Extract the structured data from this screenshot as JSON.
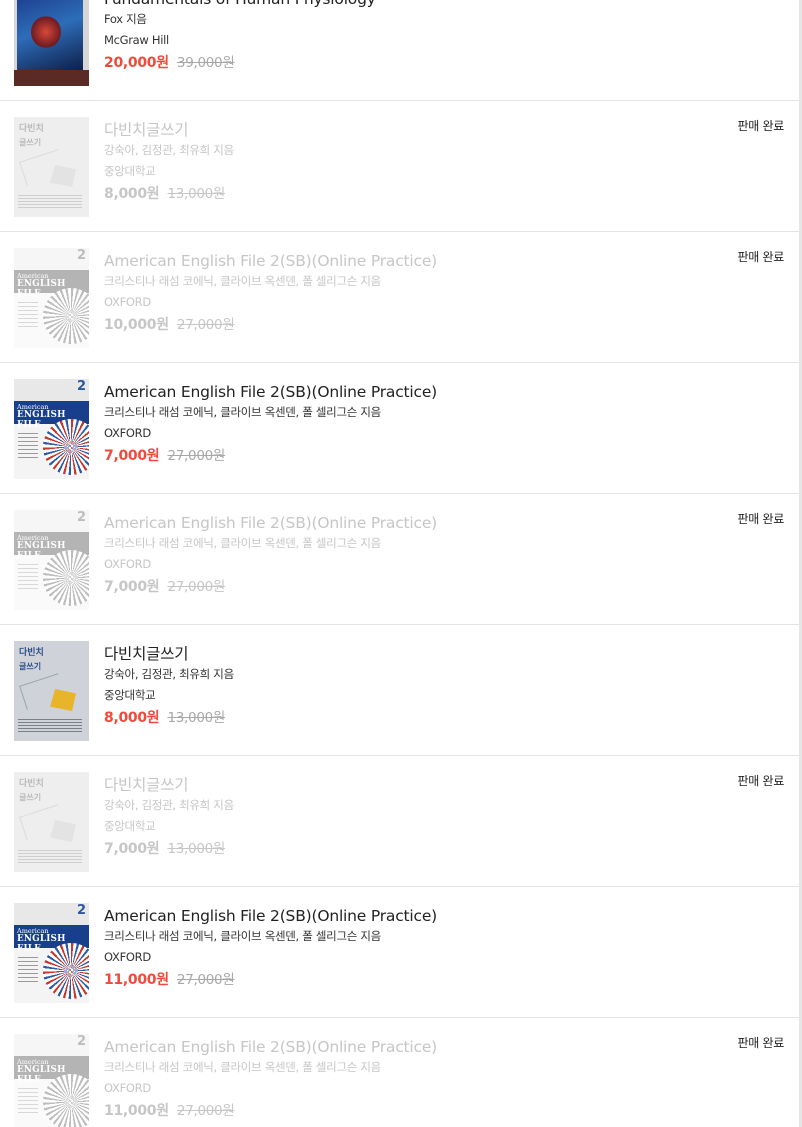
{
  "items": [
    {
      "title": "Fundamentals of Human Physiology",
      "author": "Fox 지음",
      "publisher": "McGraw Hill",
      "price": "20,000원",
      "original_price": "39,000원",
      "status": "",
      "cover_icon": "physiology-book-cover"
    },
    {
      "title": "다빈치글쓰기",
      "author": "강숙아, 김정관, 최유희 지음",
      "publisher": "중앙대학교",
      "price": "8,000원",
      "original_price": "13,000원",
      "status": "판매 완료",
      "cover_icon": "davinci-writing-book-cover"
    },
    {
      "title": "American English File 2(SB)(Online Practice)",
      "author": "크리스티나 래섬 코에닉, 클라이브 옥센덴, 폴 셀리그슨 지음",
      "publisher": "OXFORD",
      "price": "10,000원",
      "original_price": "27,000원",
      "status": "판매 완료",
      "cover_icon": "american-english-file-book-cover"
    },
    {
      "title": "American English File 2(SB)(Online Practice)",
      "author": "크리스티나 래섬 코에닉, 클라이브 옥센덴, 폴 셀리그슨 지음",
      "publisher": "OXFORD",
      "price": "7,000원",
      "original_price": "27,000원",
      "status": "",
      "cover_icon": "american-english-file-book-cover"
    },
    {
      "title": "American English File 2(SB)(Online Practice)",
      "author": "크리스티나 래섬 코에닉, 클라이브 옥센덴, 폴 셀리그슨 지음",
      "publisher": "OXFORD",
      "price": "7,000원",
      "original_price": "27,000원",
      "status": "판매 완료",
      "cover_icon": "american-english-file-book-cover"
    },
    {
      "title": "다빈치글쓰기",
      "author": "강숙아, 김정관, 최유희 지음",
      "publisher": "중앙대학교",
      "price": "8,000원",
      "original_price": "13,000원",
      "status": "",
      "cover_icon": "davinci-writing-book-cover"
    },
    {
      "title": "다빈치글쓰기",
      "author": "강숙아, 김정관, 최유희 지음",
      "publisher": "중앙대학교",
      "price": "7,000원",
      "original_price": "13,000원",
      "status": "판매 완료",
      "cover_icon": "davinci-writing-book-cover"
    },
    {
      "title": "American English File 2(SB)(Online Practice)",
      "author": "크리스티나 래섬 코에닉, 클라이브 옥센덴, 폴 셀리그슨 지음",
      "publisher": "OXFORD",
      "price": "11,000원",
      "original_price": "27,000원",
      "status": "",
      "cover_icon": "american-english-file-book-cover"
    },
    {
      "title": "American English File 2(SB)(Online Practice)",
      "author": "크리스티나 래섬 코에닉, 클라이브 옥센덴, 폴 셀리그슨 지음",
      "publisher": "OXFORD",
      "price": "11,000원",
      "original_price": "27,000원",
      "status": "판매 완료",
      "cover_icon": "american-english-file-book-cover"
    }
  ],
  "cover_text": {
    "davinci_line1": "다빈치",
    "davinci_line2": "글쓰기",
    "aef_number": "2",
    "aef_line1": "American",
    "aef_line2": "ENGLISH FILE"
  },
  "colors": {
    "sale_price": "#ef4a3b",
    "sold_out_text": "#c6c6c6",
    "divider": "#e4e4e4"
  }
}
